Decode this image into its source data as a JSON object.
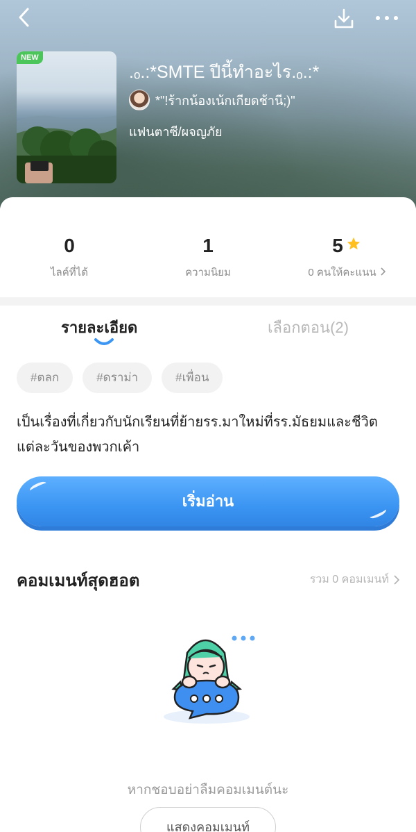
{
  "header": {
    "back_icon": "chevron-left-icon",
    "download_icon": "download-icon",
    "more_icon": "more-dots-icon"
  },
  "story": {
    "new_badge": "NEW",
    "title": ".ₒ.:*SMTE ปีนี้ทำอะไร.ₒ.:*",
    "author": "*\"!ร้ากน้องเน้กเกียดช้านี;)\"",
    "genre": "แฟนตาซี/ผจญภัย"
  },
  "stats": {
    "likes_value": "0",
    "likes_label": "ไลค์ที่ได้",
    "popularity_value": "1",
    "popularity_label": "ความนิยม",
    "rating_value": "5",
    "rating_label": "0 คนให้คะแนน"
  },
  "tabs": {
    "details": "รายละเอียด",
    "episodes": "เลือกตอน(2)"
  },
  "tags": [
    "#ตลก",
    "#ดราม่า",
    "#เพื่อน"
  ],
  "synopsis": "เป็นเรื่องที่เกี่ยวกับนักเรียนที่ย้ายรร.มาใหม่ที่รร.มัธยมและชีวิตแต่ละวันของพวกเค้า",
  "read_button": "เริ่มอ่าน",
  "comments": {
    "title": "คอมเมนท์สุดฮอต",
    "total": "รวม 0 คอมเมนท์",
    "empty_text": "หากชอบอย่าลืมคอมเมนต์นะ",
    "show_button": "แสดงคอมเมนท์"
  },
  "colors": {
    "accent_blue": "#3b95f2",
    "new_badge_green": "#4cc55a",
    "star_yellow": "#ffbf1f",
    "mascot_hair": "#4fd1a8"
  }
}
